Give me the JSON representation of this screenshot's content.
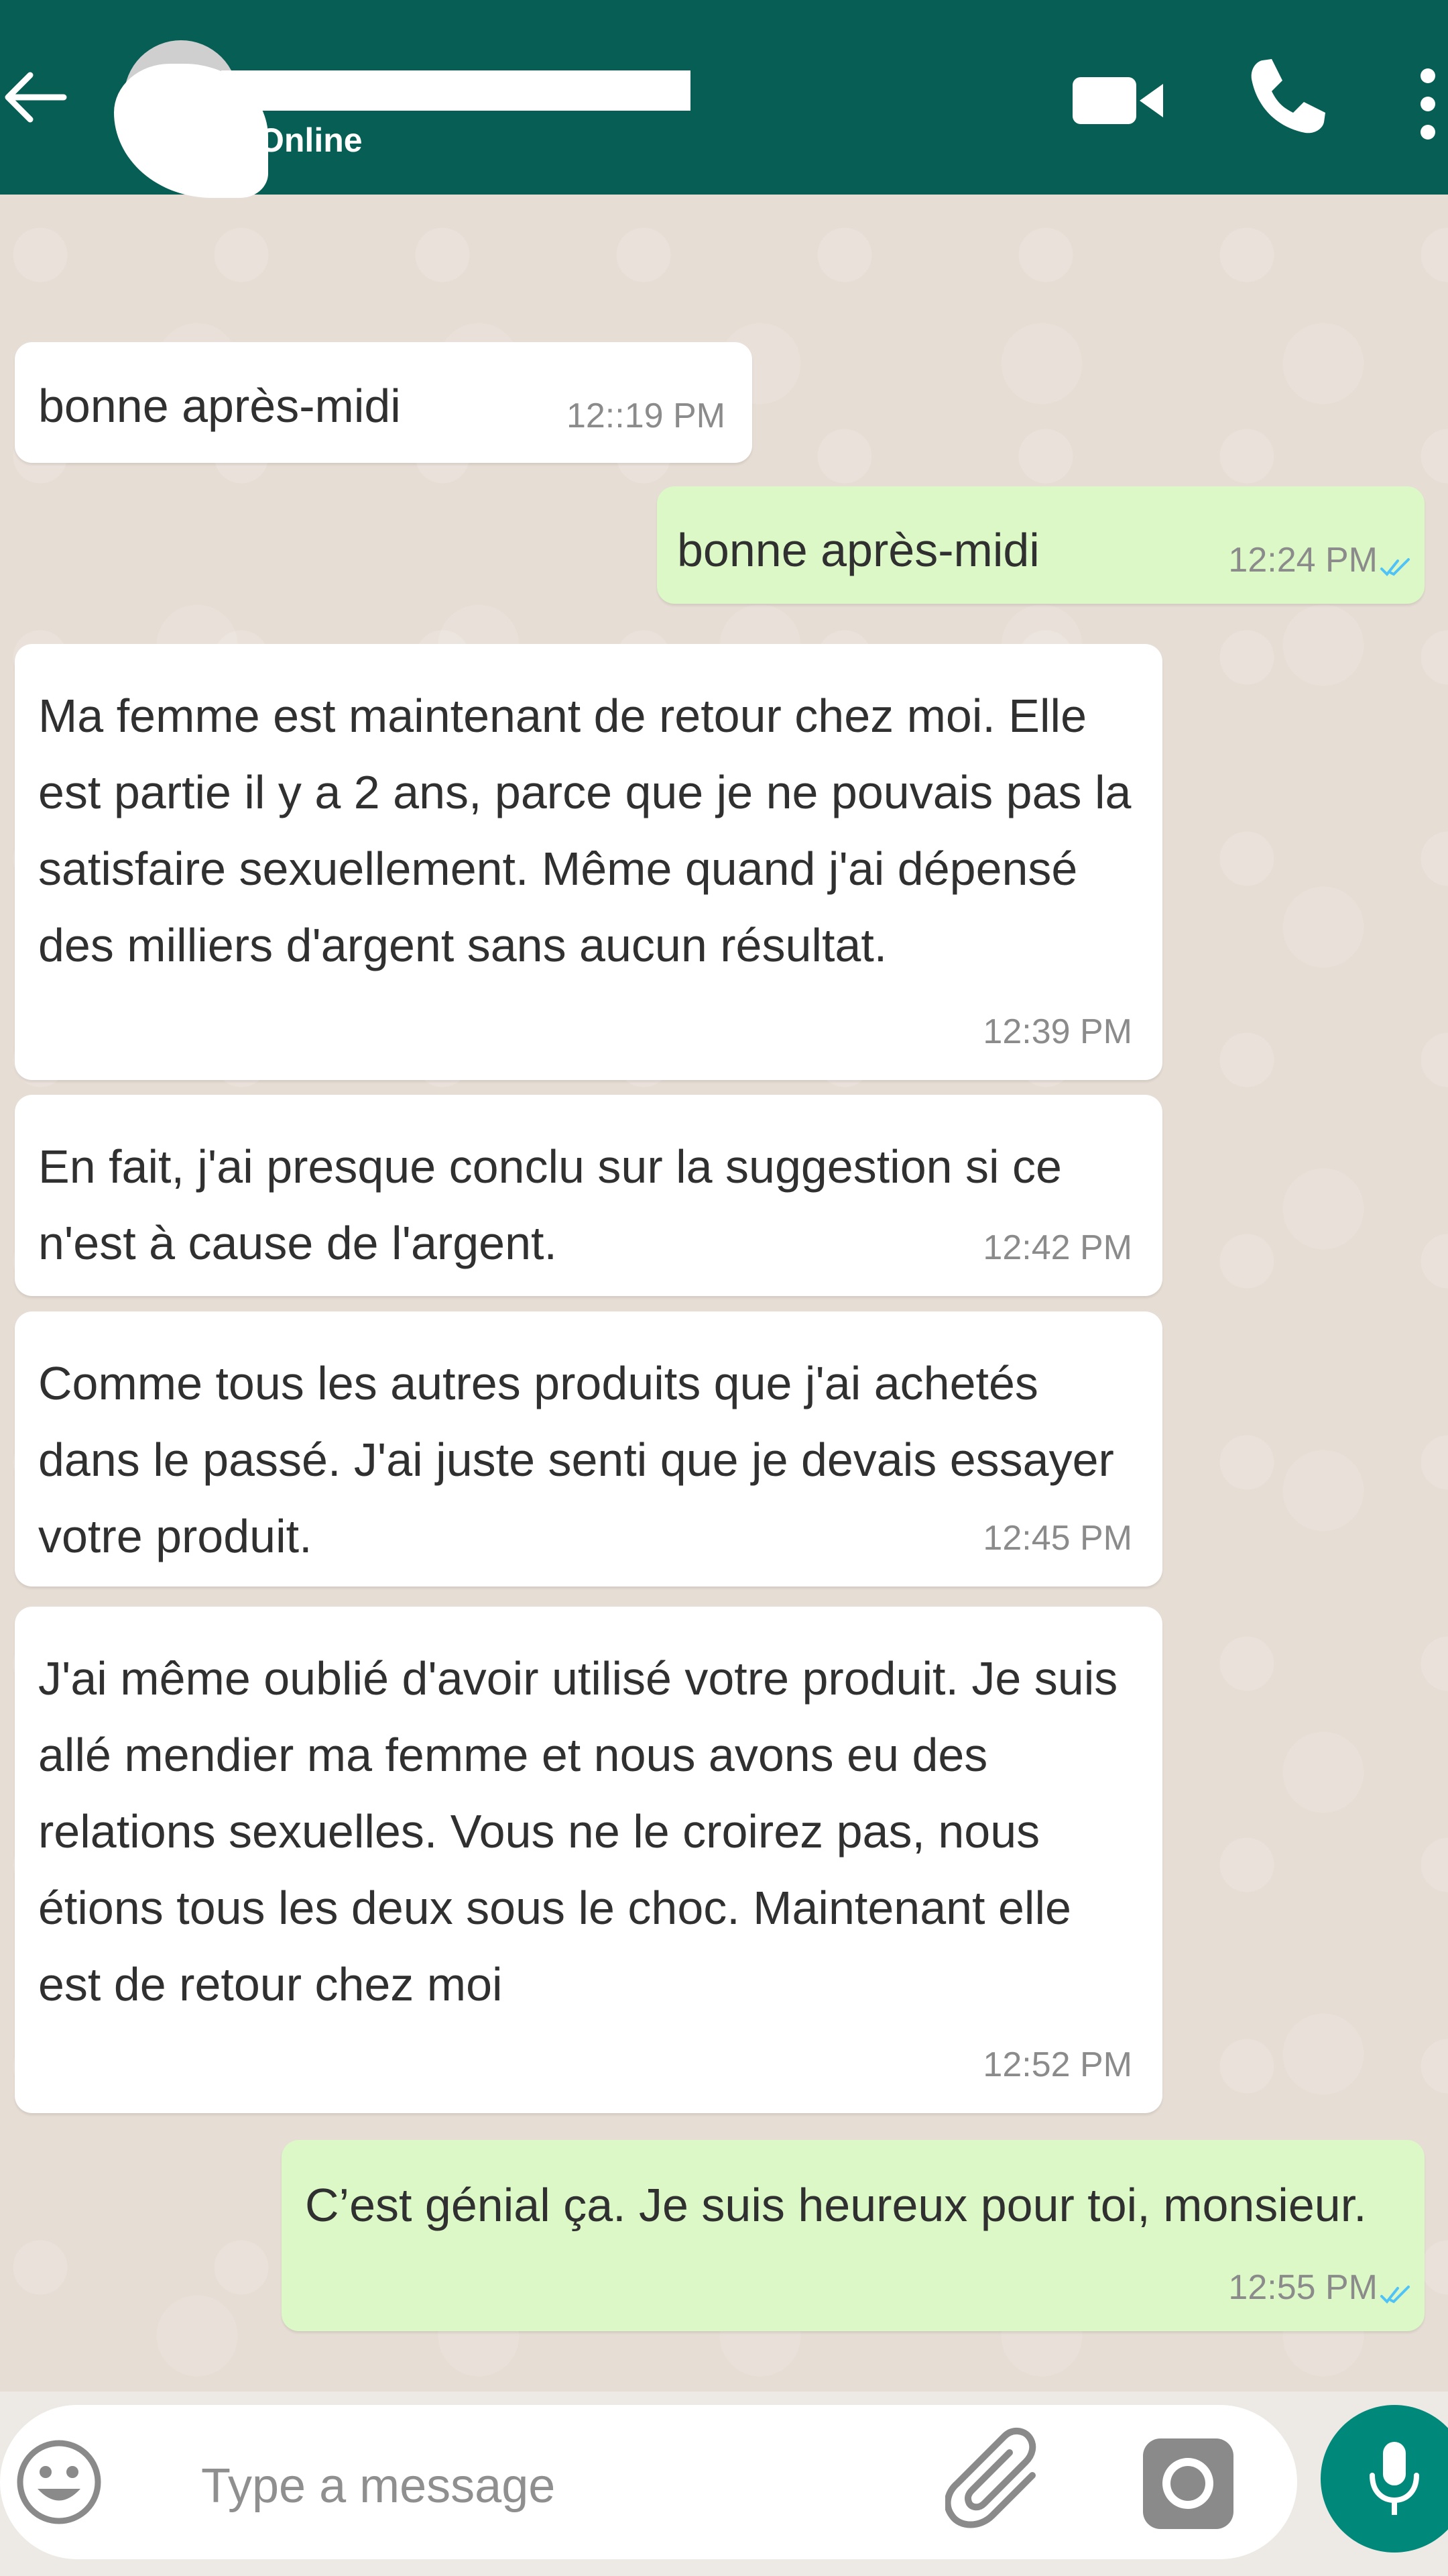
{
  "header": {
    "status": "Online",
    "icons": [
      "back-arrow-icon",
      "video-call-icon",
      "phone-icon",
      "more-vert-icon"
    ],
    "background_color": "#075e54"
  },
  "messages": [
    {
      "direction": "in",
      "text": "bonne après-midi",
      "time": "12::19 PM"
    },
    {
      "direction": "out",
      "text": "bonne après-midi",
      "time": "12:24 PM",
      "ticks": "read"
    },
    {
      "direction": "in",
      "text": "Ma femme est maintenant de retour chez moi. Elle est partie il y a 2 ans, parce que je ne pouvais pas la satisfaire sexuellement. Même quand j'ai dépensé des milliers d'argent sans aucun résultat.",
      "time": "12:39 PM"
    },
    {
      "direction": "in",
      "text": "En fait, j'ai presque conclu sur la suggestion si ce n'est à cause de l'argent.",
      "time": "12:42 PM"
    },
    {
      "direction": "in",
      "text": "Comme tous les autres produits que j'ai achetés dans le passé. J'ai juste senti que je devais essayer votre produit.",
      "time": "12:45 PM"
    },
    {
      "direction": "in",
      "text": "J'ai même oublié d'avoir utilisé votre produit. Je suis allé mendier ma femme et nous avons eu des relations sexuelles. Vous ne le croirez pas, nous étions tous les deux sous le choc. Maintenant elle est de retour chez moi",
      "time": "12:52 PM"
    },
    {
      "direction": "out",
      "text": "C’est génial ça. Je suis heureux pour toi, monsieur.",
      "time": "12:55 PM",
      "ticks": "read"
    }
  ],
  "composer": {
    "placeholder": "Type a message",
    "icons": [
      "emoji-icon",
      "attach-icon",
      "camera-icon",
      "mic-icon"
    ],
    "accent_color": "#00897b"
  },
  "colors": {
    "incoming_bubble": "#ffffff",
    "outgoing_bubble": "#dcf8c6",
    "read_ticks": "#4fc3f7"
  }
}
